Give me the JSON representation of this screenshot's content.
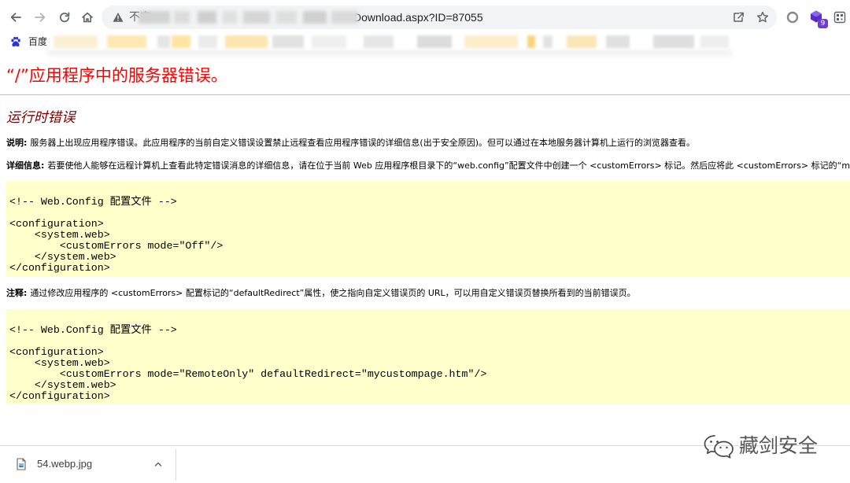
{
  "browser": {
    "nav": {
      "back_icon": "arrow-left-icon",
      "forward_icon": "arrow-right-icon",
      "reload_icon": "reload-icon",
      "home_icon": "home-icon"
    },
    "omnibox": {
      "security_icon": "warning-triangle-icon",
      "security_label": "不安",
      "url": "Download.aspx?ID=87055",
      "share_icon": "share-icon",
      "bookmark_icon": "star-icon"
    },
    "extensions": [
      {
        "icon": "circle-extension-icon"
      },
      {
        "icon": "cube-extension-icon",
        "badge": "9"
      },
      {
        "icon": "grid-extension-icon"
      }
    ],
    "bookmarks": [
      {
        "icon": "baidu-paw-icon",
        "label": "百度"
      }
    ]
  },
  "page": {
    "title": "“/”应用程序中的服务器错误。",
    "subtitle": "运行时错误",
    "description": {
      "label": "说明:",
      "text": "服务器上出现应用程序错误。此应用程序的当前自定义错误设置禁止远程查看应用程序错误的详细信息(出于安全原因)。但可以通过在本地服务器计算机上运行的浏览器查看。"
    },
    "details": {
      "label": "详细信息:",
      "text": "若要使他人能够在远程计算机上查看此特定错误消息的详细信息，请在位于当前 Web 应用程序根目录下的“web.config”配置文件中创建一个 <customErrors> 标记。然后应将此 <customErrors> 标记的“mode"
    },
    "config_example_1": {
      "lines": [
        "<!-- Web.Config 配置文件 -->",
        "",
        "<configuration>",
        "    <system.web>",
        "        <customErrors mode=\"Off\"/>",
        "    </system.web>",
        "</configuration>"
      ]
    },
    "notes": {
      "label": "注释:",
      "text": "通过修改应用程序的 <customErrors> 配置标记的“defaultRedirect”属性，使之指向自定义错误页的 URL，可以用自定义错误页替换所看到的当前错误页。"
    },
    "config_example_2": {
      "lines": [
        "<!-- Web.Config 配置文件 -->",
        "",
        "<configuration>",
        "    <system.web>",
        "        <customErrors mode=\"RemoteOnly\" defaultRedirect=\"mycustompage.htm\"/>",
        "    </system.web>",
        "</configuration>"
      ]
    }
  },
  "downloads": {
    "items": [
      {
        "icon": "file-icon",
        "filename": "54.webp.jpg",
        "menu_icon": "chevron-up-icon"
      }
    ]
  },
  "watermark": {
    "icon": "wechat-icon",
    "text": "藏剑安全"
  },
  "colors": {
    "title": "#ff0000",
    "subtitle": "#800000",
    "code_background": "#ffffcc",
    "omnibox_background": "#f1f3f4",
    "extension_badge": "#6b3fd6",
    "bookmark_baidu": "#2932e1"
  }
}
